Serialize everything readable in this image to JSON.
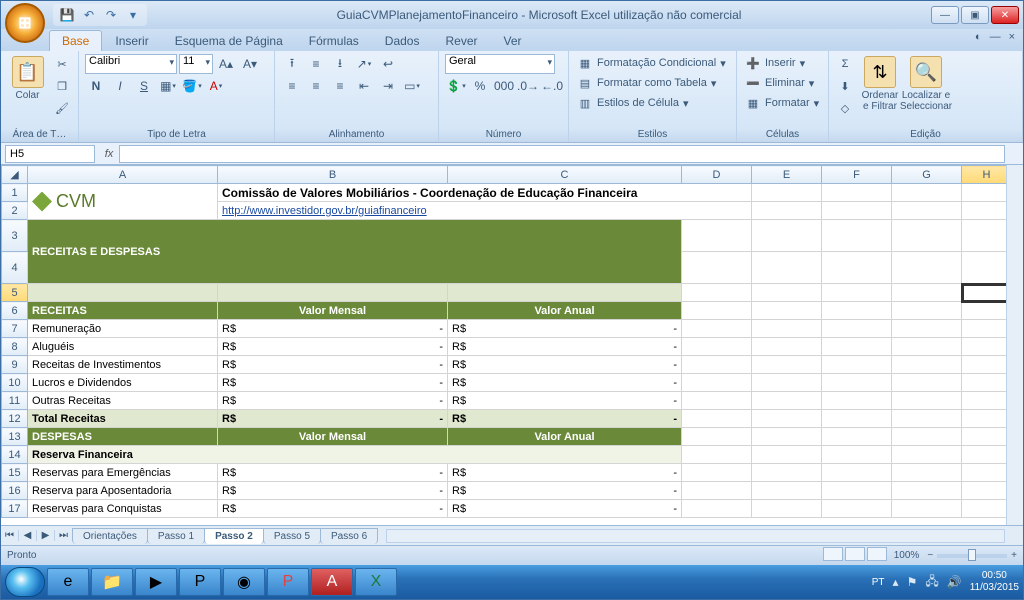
{
  "window": {
    "title": "GuiaCVMPlanejamentoFinanceiro - Microsoft Excel utilização não comercial"
  },
  "ribbon": {
    "tabs": [
      "Base",
      "Inserir",
      "Esquema de Página",
      "Fórmulas",
      "Dados",
      "Rever",
      "Ver"
    ],
    "active_tab": "Base",
    "groups": {
      "clipboard": {
        "label": "Área de T…",
        "paste": "Colar"
      },
      "font": {
        "label": "Tipo de Letra",
        "name": "Calibri",
        "size": "11"
      },
      "alignment": {
        "label": "Alinhamento"
      },
      "number": {
        "label": "Número",
        "format": "Geral"
      },
      "styles": {
        "label": "Estilos",
        "cond": "Formatação Condicional",
        "table": "Formatar como Tabela",
        "cell": "Estilos de Célula"
      },
      "cells": {
        "label": "Células",
        "insert": "Inserir",
        "delete": "Eliminar",
        "format": "Formatar"
      },
      "editing": {
        "label": "Edição",
        "sort": "Ordenar e Filtrar",
        "find": "Localizar e Seleccionar"
      }
    }
  },
  "formula_bar": {
    "cell_ref": "H5",
    "fx": "fx",
    "value": ""
  },
  "columns": [
    "A",
    "B",
    "C",
    "D",
    "E",
    "F",
    "G",
    "H"
  ],
  "sheet": {
    "logo_text": "CVM",
    "heading": "Comissão de Valores Mobiliários - Coordenação de Educação Financeira",
    "link": "http://www.investidor.gov.br/guiafinanceiro",
    "band": "RECEITAS E DESPESAS",
    "col_mensal": "Valor Mensal",
    "col_anual": "Valor Anual",
    "sec_receitas": "RECEITAS",
    "sec_despesas": "DESPESAS",
    "rows_receitas": [
      {
        "n": 7,
        "label": "Remuneração",
        "b": "R$",
        "b2": "-",
        "c": "R$",
        "c2": "-"
      },
      {
        "n": 8,
        "label": "Aluguéis",
        "b": "R$",
        "b2": "-",
        "c": "R$",
        "c2": "-"
      },
      {
        "n": 9,
        "label": "Receitas de Investimentos",
        "b": "R$",
        "b2": "-",
        "c": "R$",
        "c2": "-"
      },
      {
        "n": 10,
        "label": "Lucros e Dividendos",
        "b": "R$",
        "b2": "-",
        "c": "R$",
        "c2": "-"
      },
      {
        "n": 11,
        "label": "Outras Receitas",
        "b": "R$",
        "b2": "-",
        "c": "R$",
        "c2": "-"
      }
    ],
    "total_receitas": {
      "n": 12,
      "label": "Total Receitas",
      "b": "R$",
      "b2": "-",
      "c": "R$",
      "c2": "-"
    },
    "sub_reserva": {
      "n": 14,
      "label": "Reserva Financeira"
    },
    "rows_despesas": [
      {
        "n": 15,
        "label": "Reservas para Emergências",
        "b": "R$",
        "b2": "-",
        "c": "R$",
        "c2": "-"
      },
      {
        "n": 16,
        "label": "Reserva para Aposentadoria",
        "b": "R$",
        "b2": "-",
        "c": "R$",
        "c2": "-"
      },
      {
        "n": 17,
        "label": "Reservas para Conquistas",
        "b": "R$",
        "b2": "-",
        "c": "R$",
        "c2": "-"
      }
    ]
  },
  "sheet_tabs": [
    "Orientações",
    "Passo 1",
    "Passo 2",
    "Passo 5",
    "Passo 6"
  ],
  "active_sheet": "Passo 2",
  "status": {
    "ready": "Pronto",
    "zoom": "100%"
  },
  "tray": {
    "lang": "PT",
    "time": "00:50",
    "date": "11/03/2015"
  }
}
